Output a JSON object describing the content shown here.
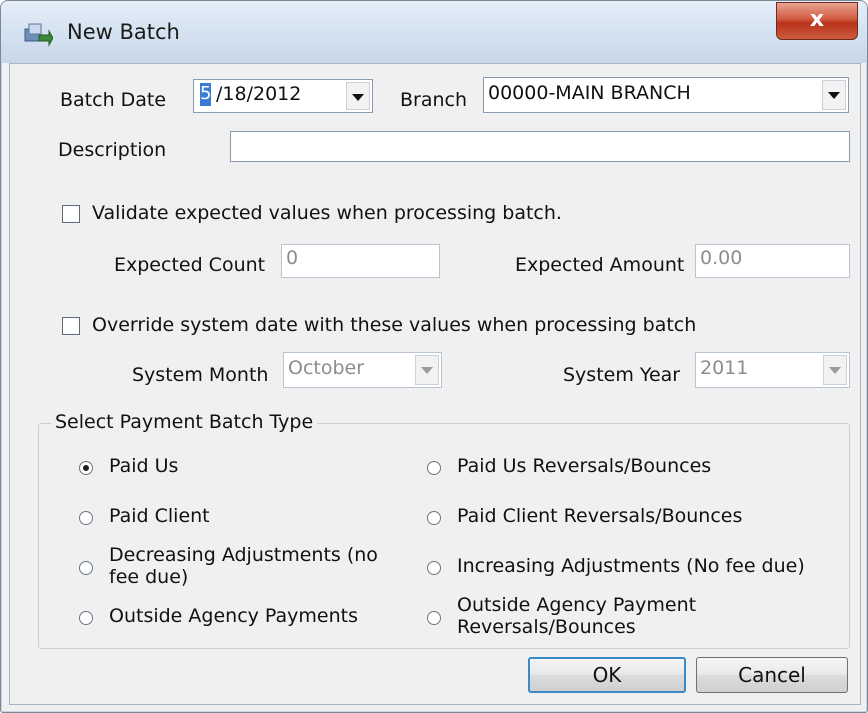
{
  "window": {
    "title": "New Batch",
    "close_glyph": "x"
  },
  "form": {
    "batch_date_label": "Batch Date",
    "batch_date_month": "5",
    "batch_date_rest": "/18/2012",
    "branch_label": "Branch",
    "branch_value": "00000-MAIN  BRANCH",
    "description_label": "Description",
    "description_value": "",
    "validate_label": "Validate expected values when processing batch.",
    "validate_checked": false,
    "expected_count_label": "Expected Count",
    "expected_count_value": "0",
    "expected_amount_label": "Expected Amount",
    "expected_amount_value": "0.00",
    "override_label": "Override system date with these values when processing batch",
    "override_checked": false,
    "system_month_label": "System Month",
    "system_month_value": "October",
    "system_year_label": "System Year",
    "system_year_value": "2011"
  },
  "batch_type": {
    "title": "Select Payment Batch Type",
    "options": [
      {
        "label": "Paid Us",
        "selected": true
      },
      {
        "label": "Paid Client",
        "selected": false
      },
      {
        "label_line1": "Decreasing Adjustments (no",
        "label_line2": "fee due)",
        "selected": false
      },
      {
        "label": "Outside Agency Payments",
        "selected": false
      },
      {
        "label": "Paid Us Reversals/Bounces",
        "selected": false
      },
      {
        "label": "Paid Client Reversals/Bounces",
        "selected": false
      },
      {
        "label": "Increasing Adjustments (No fee due)",
        "selected": false
      },
      {
        "label_line1": "Outside Agency Payment",
        "label_line2": "Reversals/Bounces",
        "selected": false
      }
    ]
  },
  "buttons": {
    "ok": "OK",
    "cancel": "Cancel"
  },
  "icons": {
    "title": "batch-window-icon",
    "dropdown": "chevron-down-icon",
    "close": "close-icon"
  },
  "colors": {
    "close_button": "#c8452b",
    "selection": "#3a7bd5",
    "default_button_border": "#3a8ac8"
  }
}
